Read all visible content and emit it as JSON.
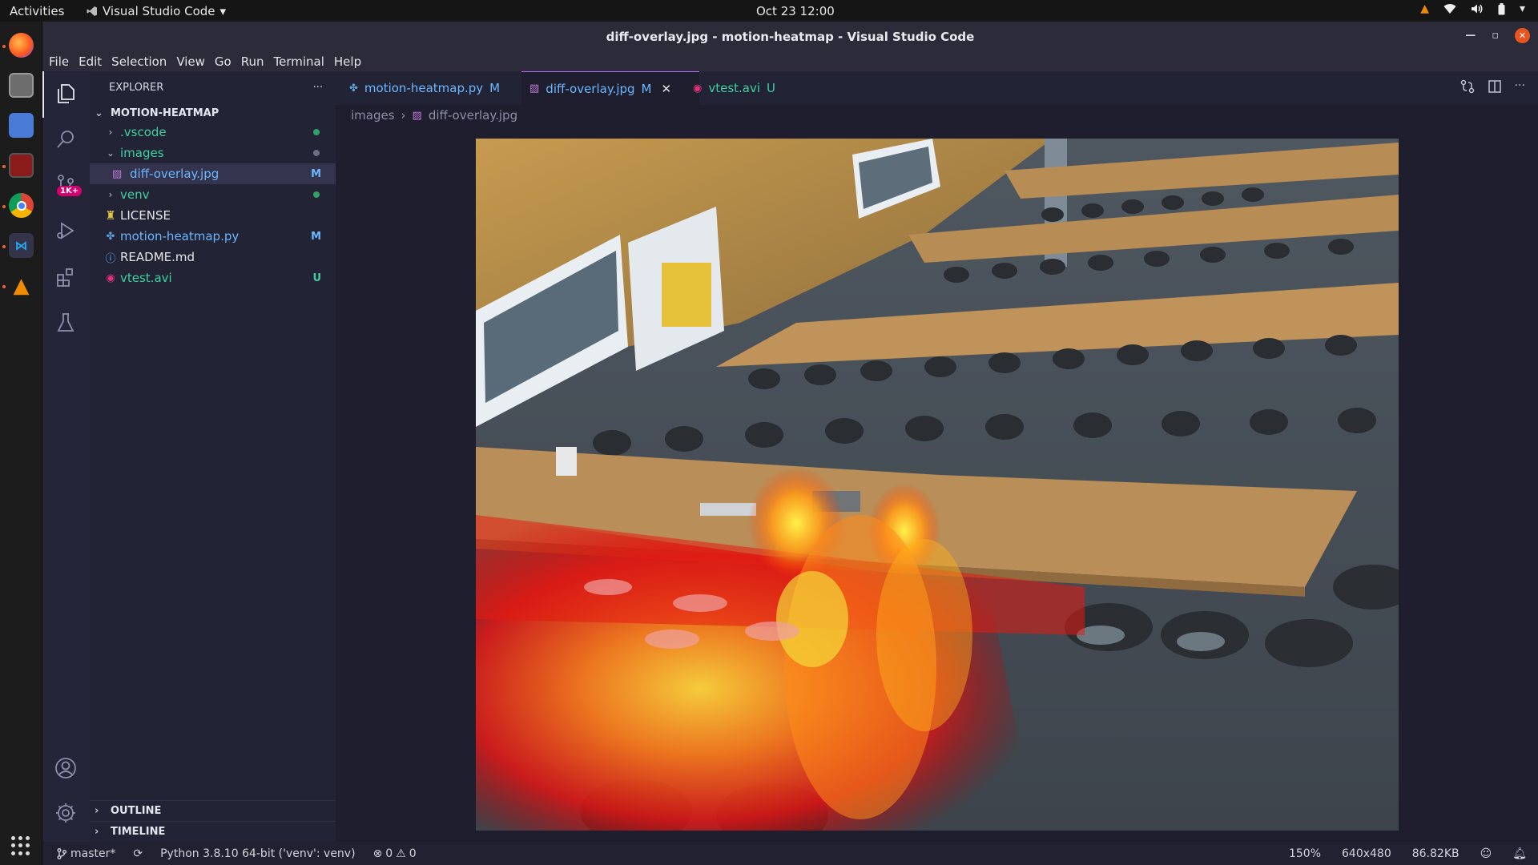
{
  "system": {
    "activities": "Activities",
    "app_menu": "Visual Studio Code",
    "clock": "Oct 23  12:00"
  },
  "window": {
    "title": "diff-overlay.jpg - motion-heatmap - Visual Studio Code"
  },
  "menu": [
    "File",
    "Edit",
    "Selection",
    "View",
    "Go",
    "Run",
    "Terminal",
    "Help"
  ],
  "activity_bar": {
    "scm_badge": "1K+"
  },
  "explorer": {
    "header": "EXPLORER",
    "more": "···",
    "project": "MOTION-HEATMAP",
    "items": [
      {
        "label": ".vscode",
        "type": "folder",
        "open": false,
        "color": "#3fd0a0",
        "status": "dot"
      },
      {
        "label": "images",
        "type": "folder",
        "open": true,
        "color": "#3fd0a0",
        "status": "dot-dim"
      },
      {
        "label": "diff-overlay.jpg",
        "type": "file",
        "color": "#6bb7ff",
        "status": "M"
      },
      {
        "label": "venv",
        "type": "folder",
        "open": false,
        "color": "#3fd0a0",
        "status": "dot"
      },
      {
        "label": "LICENSE",
        "type": "file",
        "color": "#e6e6e6",
        "status": ""
      },
      {
        "label": "motion-heatmap.py",
        "type": "file",
        "color": "#6bb7ff",
        "status": "M"
      },
      {
        "label": "README.md",
        "type": "file",
        "color": "#e6e6e6",
        "status": ""
      },
      {
        "label": "vtest.avi",
        "type": "file",
        "color": "#3fd0a0",
        "status": "U"
      }
    ],
    "outline": "OUTLINE",
    "timeline": "TIMELINE"
  },
  "tabs": [
    {
      "label": "motion-heatmap.py",
      "status": "M",
      "color": "#6bb7ff",
      "active": false
    },
    {
      "label": "diff-overlay.jpg",
      "status": "M",
      "color": "#6bb7ff",
      "active": true
    },
    {
      "label": "vtest.avi",
      "status": "U",
      "color": "#3fd0a0",
      "active": false
    }
  ],
  "breadcrumb": {
    "folder": "images",
    "file": "diff-overlay.jpg"
  },
  "statusbar": {
    "branch": "master*",
    "interpreter": "Python 3.8.10 64-bit ('venv': venv)",
    "errors": "0",
    "warnings": "0",
    "zoom": "150%",
    "dimensions": "640x480",
    "filesize": "86.82KB"
  },
  "colors": {
    "accent": "#b070ff",
    "modified": "#6bb7ff",
    "untracked": "#3fd0a0",
    "badge": "#d6006f"
  }
}
